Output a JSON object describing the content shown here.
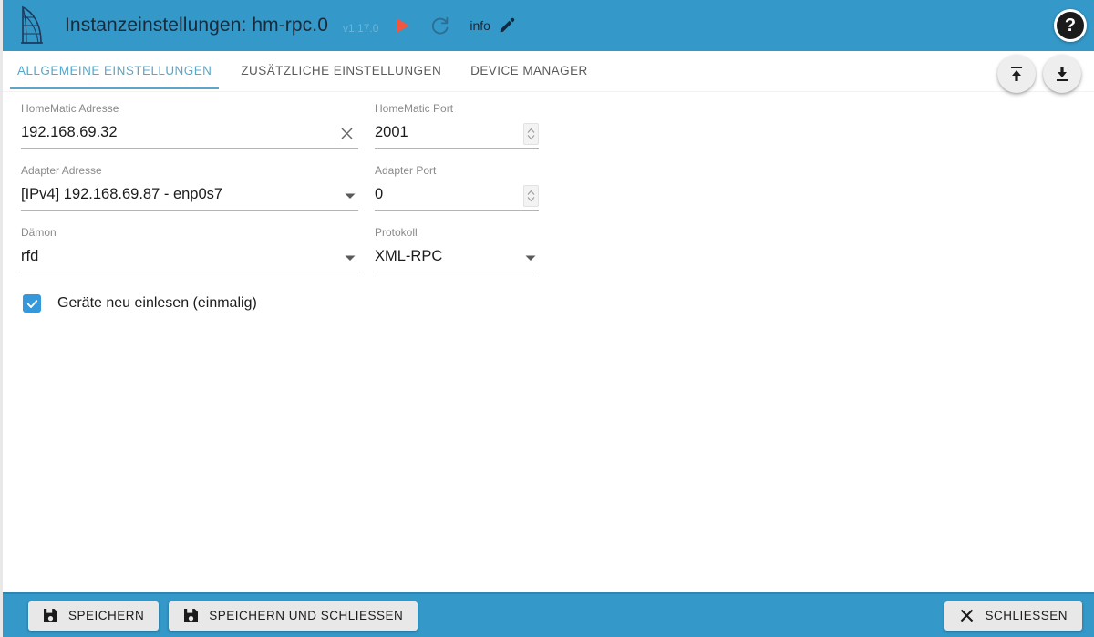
{
  "header": {
    "logo_name": "burj-al-arab-logo",
    "title": "Instanzeinstellungen: hm-rpc.0",
    "version": "v1.17.0",
    "play_icon": "play-icon",
    "refresh_icon": "refresh-icon",
    "info_label": "info",
    "pencil_icon": "pencil-edit-icon",
    "help_label": "?",
    "bg_color": "#3498c8",
    "title_color": "#1b2a38",
    "version_color": "#6bb5d8",
    "play_color": "#f4553d"
  },
  "tabs": [
    {
      "label": "ALLGEMEINE EINSTELLUNGEN",
      "active": true
    },
    {
      "label": "ZUSÄTZLICHE EINSTELLUNGEN",
      "active": false
    },
    {
      "label": "DEVICE MANAGER",
      "active": false
    }
  ],
  "tab_accent_color": "#5ba6c9",
  "fabs": [
    {
      "name": "upload-button",
      "icon": "upload-icon"
    },
    {
      "name": "download-button",
      "icon": "download-icon"
    }
  ],
  "form": {
    "homematic_address": {
      "label": "HomeMatic Adresse",
      "value": "192.168.69.32",
      "clear_icon": "clear-x-icon"
    },
    "homematic_port": {
      "label": "HomeMatic Port",
      "value": "2001",
      "stepper_icon": "stepper-updown-icon"
    },
    "adapter_address": {
      "label": "Adapter Adresse",
      "value": "[IPv4] 192.168.69.87 - enp0s7",
      "caret_icon": "chevron-down-icon"
    },
    "adapter_port": {
      "label": "Adapter Port",
      "value": "0",
      "stepper_icon": "stepper-updown-icon"
    },
    "daemon": {
      "label": "Dämon",
      "value": "rfd",
      "caret_icon": "chevron-down-icon"
    },
    "protocol": {
      "label": "Protokoll",
      "value": "XML-RPC",
      "caret_icon": "chevron-down-icon"
    },
    "reread_devices": {
      "label": "Geräte neu einlesen (einmalig)",
      "checked": true,
      "checkbox_color": "#3498db"
    }
  },
  "footer": {
    "bg_color": "#3498c8",
    "save": {
      "label": "SPEICHERN",
      "icon": "floppy-save-icon"
    },
    "save_close": {
      "label": "SPEICHERN UND SCHLIESSEN",
      "icon": "floppy-save-icon"
    },
    "close": {
      "label": "SCHLIESSEN",
      "icon": "close-x-icon"
    }
  }
}
